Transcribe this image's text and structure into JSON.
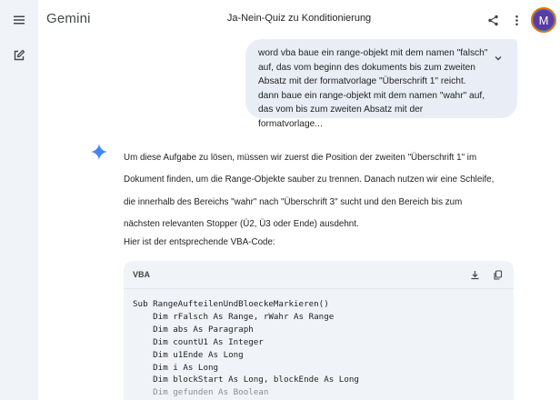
{
  "app": {
    "name": "Gemini",
    "conversation_title": "Ja-Nein-Quiz zu Konditionierung"
  },
  "user": {
    "avatar_letter": "M"
  },
  "user_message": {
    "lines": [
      "word vba baue ein range-objekt mit dem namen \"falsch\"",
      "auf, das vom beginn des dokuments bis zum zweiten",
      "Absatz mit der formatvorlage \"Überschrift 1\" reicht.",
      "dann baue ein range-objekt mit dem namen \"wahr\" auf,",
      "das vom bis zum zweiten Absatz mit der formatvorlage..."
    ]
  },
  "response": {
    "paragraph_lines": [
      "Um diese Aufgabe zu lösen, müssen wir zuerst die Position der zweiten \"Überschrift 1\" im",
      "Dokument finden, um die Range-Objekte sauber zu trennen. Danach nutzen wir eine Schleife,",
      "die innerhalb des Bereichs \"wahr\" nach \"Überschrift 3\" sucht und den Bereich bis zum",
      "nächsten relevanten Stopper (Ü2, Ü3 oder Ende) ausdehnt."
    ],
    "intro": "Hier ist der entsprechende VBA-Code:"
  },
  "code_block": {
    "language": "VBA",
    "lines": [
      "Sub RangeAufteilenUndBloeckeMarkieren()",
      "    Dim rFalsch As Range, rWahr As Range",
      "    Dim abs As Paragraph",
      "    Dim countU1 As Integer",
      "    Dim u1Ende As Long",
      "    Dim i As Long",
      "    Dim blockStart As Long, blockEnde As Long",
      "    Dim gefunden As Boolean"
    ]
  },
  "icons": [
    "menu-icon",
    "new-chat-icon",
    "share-icon",
    "more-vert-icon",
    "chevron-down-icon",
    "gemini-spark-icon",
    "download-icon",
    "copy-icon"
  ],
  "colors": {
    "rail_bg": "#f0f4f9",
    "bubble_bg": "#e9eef6",
    "code_bg": "#f0f4f9",
    "spark": "#4285f4",
    "avatar_bg": "#5b3aa3"
  }
}
